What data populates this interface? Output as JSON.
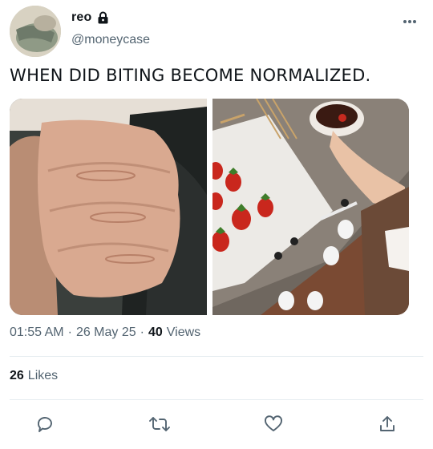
{
  "author": {
    "display_name": "reo",
    "handle": "@moneycase",
    "protected_icon": "lock-icon",
    "avatar_icon": "profile-photo"
  },
  "tweet": {
    "text": "WHEN DID BITING BECOME NORMALIZED.",
    "time": "01:55 AM",
    "separator": "·",
    "date": "26 May 25",
    "views_count": "40",
    "views_label": "Views",
    "likes_count": "26",
    "likes_label": "Likes"
  },
  "media": {
    "photo_1": "bite-marks-hand-photo",
    "photo_2": "chocolate-strawberries-photo"
  },
  "actions": {
    "reply_icon": "reply-icon",
    "retweet_icon": "retweet-icon",
    "like_icon": "heart-icon",
    "share_icon": "share-icon",
    "more_icon": "more-icon"
  },
  "colors": {
    "text_primary": "#0f1419",
    "text_secondary": "#536471",
    "divider": "#e6ecf0"
  }
}
